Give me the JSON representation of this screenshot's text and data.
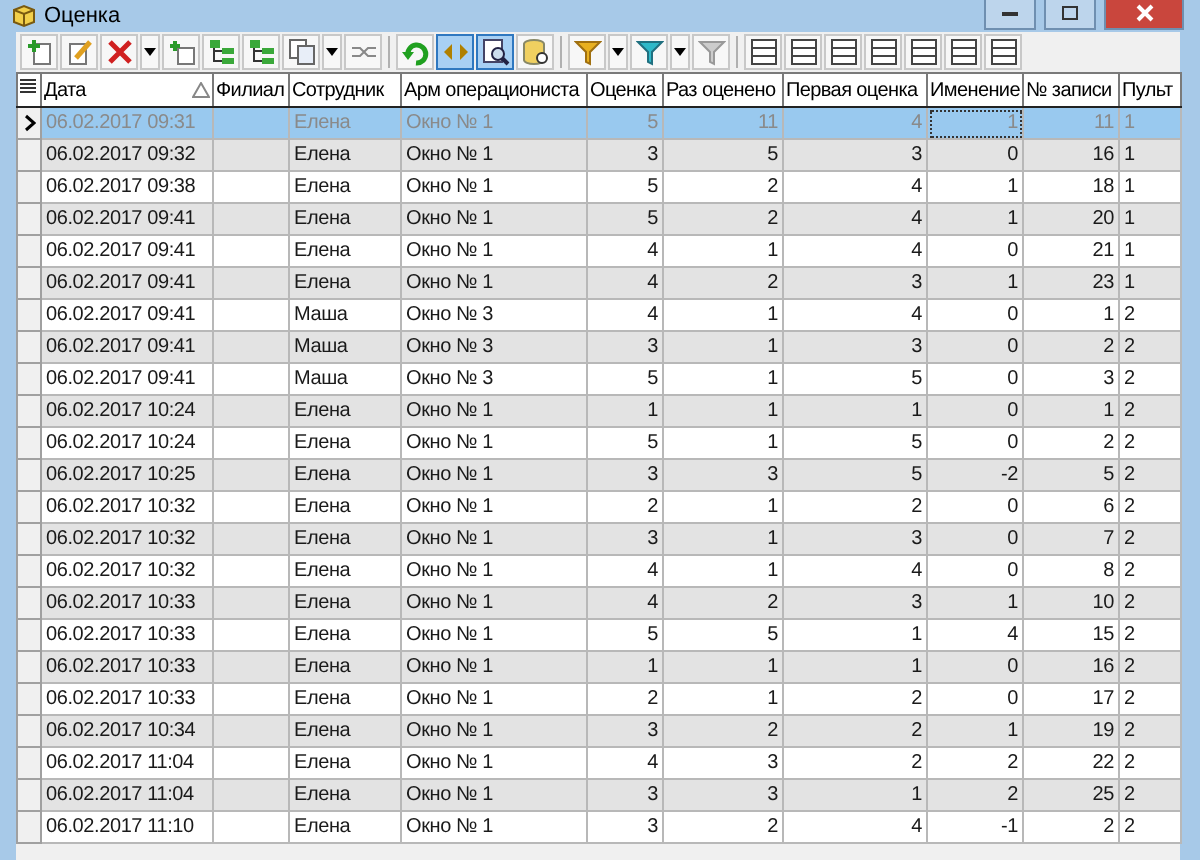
{
  "window": {
    "title": "Оценка"
  },
  "toolbar": [
    {
      "kind": "add",
      "pressed": false
    },
    {
      "kind": "edit",
      "pressed": false
    },
    {
      "kind": "delete",
      "pressed": false
    },
    {
      "kind": "dropdown",
      "pressed": false
    },
    {
      "kind": "copy-row",
      "pressed": false
    },
    {
      "kind": "tree",
      "pressed": false
    },
    {
      "kind": "tree",
      "pressed": false
    },
    {
      "kind": "copy",
      "pressed": false
    },
    {
      "kind": "dropdown",
      "pressed": false
    },
    {
      "kind": "link",
      "pressed": false
    },
    {
      "kind": "separator"
    },
    {
      "kind": "refresh",
      "pressed": false
    },
    {
      "kind": "arrows",
      "pressed": true
    },
    {
      "kind": "search",
      "pressed": true
    },
    {
      "kind": "database",
      "pressed": false
    },
    {
      "kind": "separator"
    },
    {
      "kind": "filter",
      "pressed": false
    },
    {
      "kind": "dropdown",
      "pressed": false
    },
    {
      "kind": "filter-cyan",
      "pressed": false
    },
    {
      "kind": "dropdown",
      "pressed": false
    },
    {
      "kind": "filter-grey",
      "pressed": false
    },
    {
      "kind": "separator"
    },
    {
      "kind": "layout",
      "pressed": false
    },
    {
      "kind": "layout",
      "pressed": false
    },
    {
      "kind": "layout",
      "pressed": false
    },
    {
      "kind": "layout",
      "pressed": false
    },
    {
      "kind": "layout",
      "pressed": false
    },
    {
      "kind": "layout",
      "pressed": false
    },
    {
      "kind": "layout",
      "pressed": false
    }
  ],
  "table": {
    "columns": [
      {
        "label": "Дата",
        "sorted": true
      },
      {
        "label": "Филиал",
        "sorted": false
      },
      {
        "label": "Сотрудник",
        "sorted": false
      },
      {
        "label": "Арм операциониста",
        "sorted": false
      },
      {
        "label": "Оценка",
        "sorted": false
      },
      {
        "label": "Раз оценено",
        "sorted": false
      },
      {
        "label": "Первая оценка",
        "sorted": false
      },
      {
        "label": "Именение",
        "sorted": false
      },
      {
        "label": "№ записи",
        "sorted": false
      },
      {
        "label": "Пульт",
        "sorted": false
      }
    ],
    "rows": [
      {
        "selected": true,
        "cells": [
          "06.02.2017 09:31",
          "",
          "Елена",
          "Окно № 1",
          "5",
          "11",
          "4",
          "1",
          "11",
          "1"
        ]
      },
      {
        "selected": false,
        "cells": [
          "06.02.2017 09:32",
          "",
          "Елена",
          "Окно № 1",
          "3",
          "5",
          "3",
          "0",
          "16",
          "1"
        ]
      },
      {
        "selected": false,
        "cells": [
          "06.02.2017 09:38",
          "",
          "Елена",
          "Окно № 1",
          "5",
          "2",
          "4",
          "1",
          "18",
          "1"
        ]
      },
      {
        "selected": false,
        "cells": [
          "06.02.2017 09:41",
          "",
          "Елена",
          "Окно № 1",
          "5",
          "2",
          "4",
          "1",
          "20",
          "1"
        ]
      },
      {
        "selected": false,
        "cells": [
          "06.02.2017 09:41",
          "",
          "Елена",
          "Окно № 1",
          "4",
          "1",
          "4",
          "0",
          "21",
          "1"
        ]
      },
      {
        "selected": false,
        "cells": [
          "06.02.2017 09:41",
          "",
          "Елена",
          "Окно № 1",
          "4",
          "2",
          "3",
          "1",
          "23",
          "1"
        ]
      },
      {
        "selected": false,
        "cells": [
          "06.02.2017 09:41",
          "",
          "Маша",
          "Окно № 3",
          "4",
          "1",
          "4",
          "0",
          "1",
          "2"
        ]
      },
      {
        "selected": false,
        "cells": [
          "06.02.2017 09:41",
          "",
          "Маша",
          "Окно № 3",
          "3",
          "1",
          "3",
          "0",
          "2",
          "2"
        ]
      },
      {
        "selected": false,
        "cells": [
          "06.02.2017 09:41",
          "",
          "Маша",
          "Окно № 3",
          "5",
          "1",
          "5",
          "0",
          "3",
          "2"
        ]
      },
      {
        "selected": false,
        "cells": [
          "06.02.2017 10:24",
          "",
          "Елена",
          "Окно № 1",
          "1",
          "1",
          "1",
          "0",
          "1",
          "2"
        ]
      },
      {
        "selected": false,
        "cells": [
          "06.02.2017 10:24",
          "",
          "Елена",
          "Окно № 1",
          "5",
          "1",
          "5",
          "0",
          "2",
          "2"
        ]
      },
      {
        "selected": false,
        "cells": [
          "06.02.2017 10:25",
          "",
          "Елена",
          "Окно № 1",
          "3",
          "3",
          "5",
          "-2",
          "5",
          "2"
        ]
      },
      {
        "selected": false,
        "cells": [
          "06.02.2017 10:32",
          "",
          "Елена",
          "Окно № 1",
          "2",
          "1",
          "2",
          "0",
          "6",
          "2"
        ]
      },
      {
        "selected": false,
        "cells": [
          "06.02.2017 10:32",
          "",
          "Елена",
          "Окно № 1",
          "3",
          "1",
          "3",
          "0",
          "7",
          "2"
        ]
      },
      {
        "selected": false,
        "cells": [
          "06.02.2017 10:32",
          "",
          "Елена",
          "Окно № 1",
          "4",
          "1",
          "4",
          "0",
          "8",
          "2"
        ]
      },
      {
        "selected": false,
        "cells": [
          "06.02.2017 10:33",
          "",
          "Елена",
          "Окно № 1",
          "4",
          "2",
          "3",
          "1",
          "10",
          "2"
        ]
      },
      {
        "selected": false,
        "cells": [
          "06.02.2017 10:33",
          "",
          "Елена",
          "Окно № 1",
          "5",
          "5",
          "1",
          "4",
          "15",
          "2"
        ]
      },
      {
        "selected": false,
        "cells": [
          "06.02.2017 10:33",
          "",
          "Елена",
          "Окно № 1",
          "1",
          "1",
          "1",
          "0",
          "16",
          "2"
        ]
      },
      {
        "selected": false,
        "cells": [
          "06.02.2017 10:33",
          "",
          "Елена",
          "Окно № 1",
          "2",
          "1",
          "2",
          "0",
          "17",
          "2"
        ]
      },
      {
        "selected": false,
        "cells": [
          "06.02.2017 10:34",
          "",
          "Елена",
          "Окно № 1",
          "3",
          "2",
          "2",
          "1",
          "19",
          "2"
        ]
      },
      {
        "selected": false,
        "cells": [
          "06.02.2017 11:04",
          "",
          "Елена",
          "Окно № 1",
          "4",
          "3",
          "2",
          "2",
          "22",
          "2"
        ]
      },
      {
        "selected": false,
        "cells": [
          "06.02.2017 11:04",
          "",
          "Елена",
          "Окно № 1",
          "3",
          "3",
          "1",
          "2",
          "25",
          "2"
        ]
      },
      {
        "selected": false,
        "cells": [
          "06.02.2017 11:10",
          "",
          "Елена",
          "Окно № 1",
          "3",
          "2",
          "4",
          "-1",
          "2",
          "2"
        ]
      }
    ]
  }
}
